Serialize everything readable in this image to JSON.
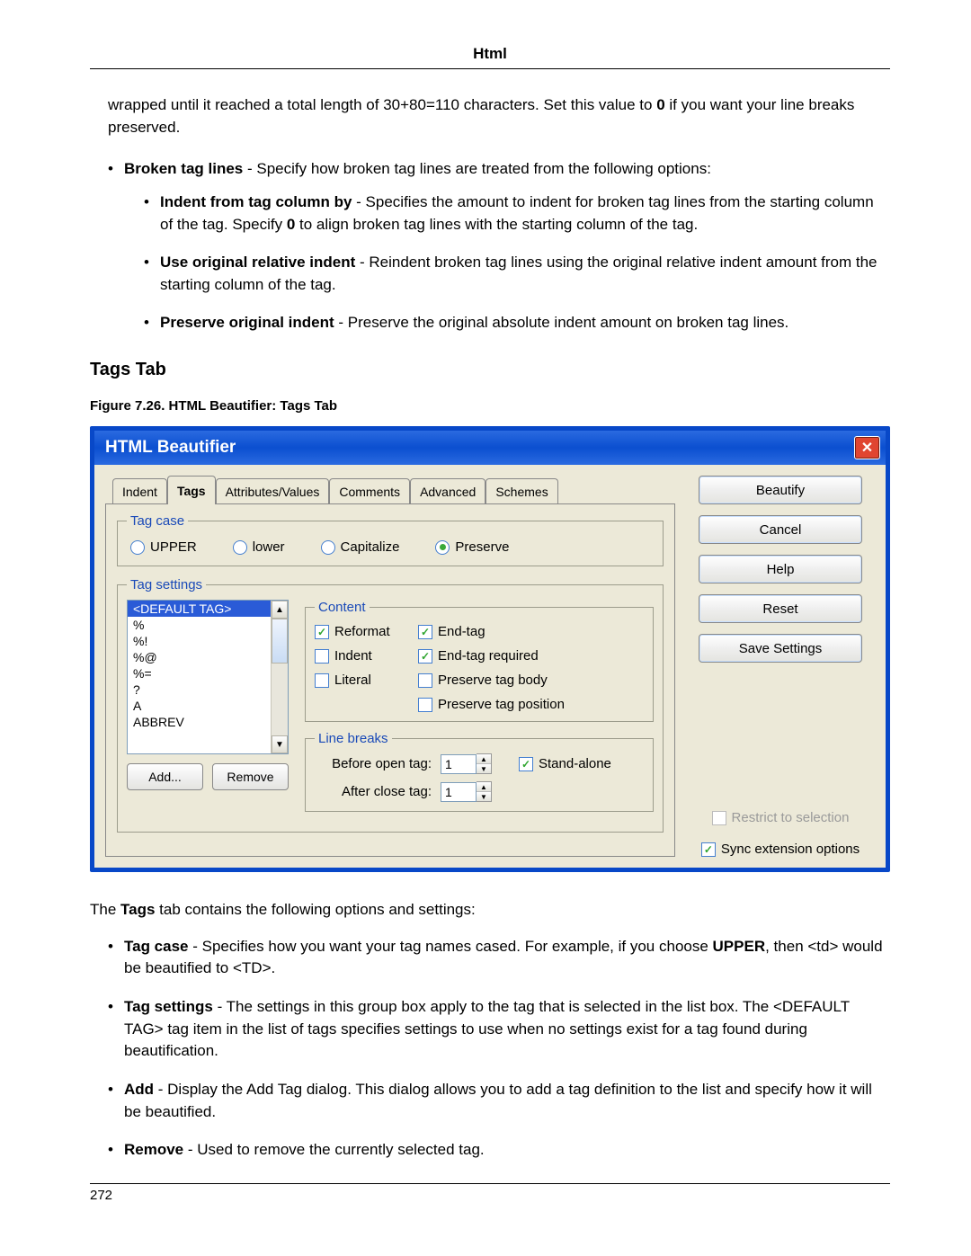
{
  "header_title": "Html",
  "intro_text": "wrapped until it reached a total length of 30+80=110 characters. Set this value to ",
  "intro_bold": "0",
  "intro_text2": " if you want your line breaks preserved.",
  "bullets_top": {
    "broken": {
      "label": "Broken tag lines",
      "text": " - Specify how broken tag lines are treated from the following options:"
    },
    "indent": {
      "label": "Indent from tag column by",
      "text": " - Specifies the amount to indent for broken tag lines from the starting column of the tag. Specify ",
      "bold": "0",
      "text2": " to align broken tag lines with the starting column of the tag."
    },
    "useorig": {
      "label": "Use original relative indent",
      "text": " - Reindent broken tag lines using the original relative indent amount from the starting column of the tag."
    },
    "preserve": {
      "label": "Preserve original indent",
      "text": " - Preserve the original absolute indent amount on broken tag lines."
    }
  },
  "section_heading": "Tags Tab",
  "figure_caption": "Figure 7.26. HTML Beautifier: Tags Tab",
  "dialog": {
    "title": "HTML Beautifier",
    "tabs": [
      "Indent",
      "Tags",
      "Attributes/Values",
      "Comments",
      "Advanced",
      "Schemes"
    ],
    "active_tab": "Tags",
    "tagcase": {
      "legend": "Tag case",
      "upper": "UPPER",
      "lower": "lower",
      "capitalize": "Capitalize",
      "preserve": "Preserve"
    },
    "tagsettings": {
      "legend": "Tag settings",
      "items": [
        "<DEFAULT TAG>",
        "%",
        "%!",
        "%@",
        "%=",
        "?",
        "A",
        "ABBREV"
      ],
      "add": "Add...",
      "remove": "Remove"
    },
    "content": {
      "legend": "Content",
      "reformat": "Reformat",
      "indent": "Indent",
      "literal": "Literal",
      "endtag": "End-tag",
      "endtagreq": "End-tag required",
      "presbody": "Preserve tag body",
      "prespos": "Preserve tag position"
    },
    "linebreaks": {
      "legend": "Line breaks",
      "before": "Before open tag:",
      "after": "After close tag:",
      "before_val": "1",
      "after_val": "1",
      "standalone": "Stand-alone"
    },
    "buttons": {
      "beautify": "Beautify",
      "cancel": "Cancel",
      "help": "Help",
      "reset": "Reset",
      "save": "Save Settings"
    },
    "restrict": "Restrict to selection",
    "sync": "Sync extension options"
  },
  "under_para_pre": "The ",
  "under_para_bold": "Tags",
  "under_para_post": " tab contains the following options and settings:",
  "list2": {
    "tagcase": {
      "label": "Tag case",
      "text": " - Specifies how you want your tag names cased. For example, if you choose ",
      "bold": "UPPER",
      "text2": ", then <td> would be beautified to <TD>."
    },
    "tagsettings": {
      "label": "Tag settings",
      "text": " - The settings in this group box apply to the tag that is selected in the list box. The <DEFAULT TAG> tag item in the list of tags specifies settings to use when no settings exist for a tag found during beautification."
    },
    "add": {
      "label": "Add",
      "text": " - Display the Add Tag dialog. This dialog allows you to add a tag definition to the list and specify how it will be beautified."
    },
    "remove": {
      "label": "Remove",
      "text": " - Used to remove the currently selected tag."
    }
  },
  "page_number": "272"
}
